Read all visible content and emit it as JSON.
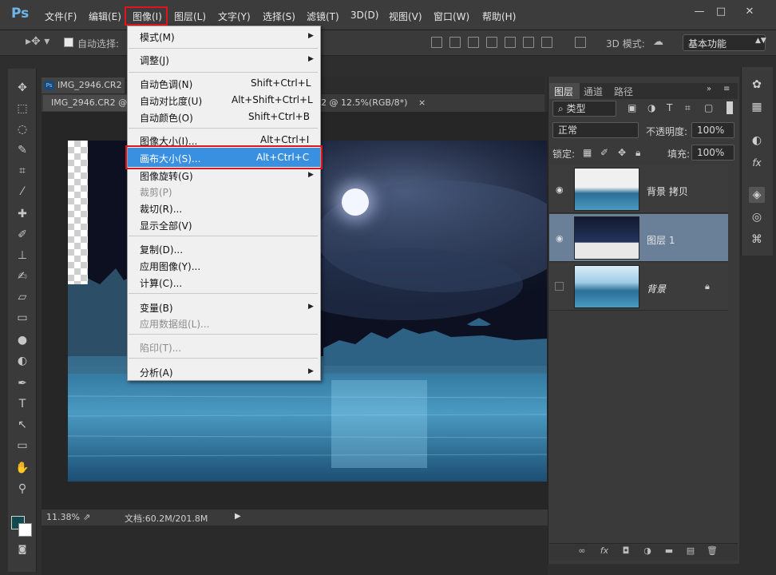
{
  "app": {
    "logo": "Ps"
  },
  "menubar": {
    "items": [
      "文件(F)",
      "编辑(E)",
      "图像(I)",
      "图层(L)",
      "文字(Y)",
      "选择(S)",
      "滤镜(T)",
      "3D(D)",
      "视图(V)",
      "窗口(W)",
      "帮助(H)"
    ]
  },
  "window_controls": {
    "minimize": "—",
    "restore": "□",
    "close": "✕"
  },
  "options_bar": {
    "auto_select_label": "自动选择:",
    "mode_3d_label": "3D 模式:",
    "workspace": "基本功能"
  },
  "tabs": {
    "doc1": "IMG_2946.CR2",
    "doc2": "IMG_2946.CR2 @",
    "doc3": "2 @ 12.5%(RGB/8*)",
    "doc3_close": "×"
  },
  "status": {
    "zoom": "11.38%",
    "doc": "文档:60.2M/201.8M"
  },
  "image_menu": {
    "items": [
      {
        "label": "模式(M)",
        "shortcut": "",
        "submenu": true,
        "disabled": false
      },
      {
        "label": "调整(J)",
        "shortcut": "",
        "submenu": true,
        "disabled": false
      },
      {
        "label": "自动色调(N)",
        "shortcut": "Shift+Ctrl+L",
        "submenu": false,
        "disabled": false
      },
      {
        "label": "自动对比度(U)",
        "shortcut": "Alt+Shift+Ctrl+L",
        "submenu": false,
        "disabled": false
      },
      {
        "label": "自动颜色(O)",
        "shortcut": "Shift+Ctrl+B",
        "submenu": false,
        "disabled": false
      },
      {
        "label": "图像大小(I)...",
        "shortcut": "Alt+Ctrl+I",
        "submenu": false,
        "disabled": false
      },
      {
        "label": "画布大小(S)...",
        "shortcut": "Alt+Ctrl+C",
        "submenu": false,
        "disabled": false,
        "highlighted": true
      },
      {
        "label": "图像旋转(G)",
        "shortcut": "",
        "submenu": true,
        "disabled": false
      },
      {
        "label": "裁剪(P)",
        "shortcut": "",
        "submenu": false,
        "disabled": true
      },
      {
        "label": "裁切(R)...",
        "shortcut": "",
        "submenu": false,
        "disabled": false
      },
      {
        "label": "显示全部(V)",
        "shortcut": "",
        "submenu": false,
        "disabled": false
      },
      {
        "label": "复制(D)...",
        "shortcut": "",
        "submenu": false,
        "disabled": false
      },
      {
        "label": "应用图像(Y)...",
        "shortcut": "",
        "submenu": false,
        "disabled": false
      },
      {
        "label": "计算(C)...",
        "shortcut": "",
        "submenu": false,
        "disabled": false
      },
      {
        "label": "变量(B)",
        "shortcut": "",
        "submenu": true,
        "disabled": false
      },
      {
        "label": "应用数据组(L)...",
        "shortcut": "",
        "submenu": false,
        "disabled": true
      },
      {
        "label": "陷印(T)...",
        "shortcut": "",
        "submenu": false,
        "disabled": true
      },
      {
        "label": "分析(A)",
        "shortcut": "",
        "submenu": true,
        "disabled": false
      }
    ]
  },
  "layers_panel": {
    "tabs": [
      "图层",
      "通道",
      "路径"
    ],
    "filter_kind": "类型",
    "blend_mode": "正常",
    "opacity_label": "不透明度:",
    "opacity": "100%",
    "lock_label": "锁定:",
    "fill_label": "填充:",
    "fill": "100%",
    "layers": [
      {
        "name": "背景 拷贝",
        "visible": true,
        "selected": false,
        "locked": false
      },
      {
        "name": "图层 1",
        "visible": true,
        "selected": true,
        "locked": false
      },
      {
        "name": "背景",
        "visible": false,
        "selected": false,
        "locked": true
      }
    ],
    "footer_icons": [
      "link-icon",
      "fx-icon",
      "mask-icon",
      "adjustment-icon",
      "folder-icon",
      "new-layer-icon",
      "trash-icon"
    ]
  },
  "colors": {
    "foreground": "#0e4a4e",
    "background": "#ffffff",
    "menu_highlight": "#3a90e0",
    "annotation_red": "#e0141e"
  }
}
